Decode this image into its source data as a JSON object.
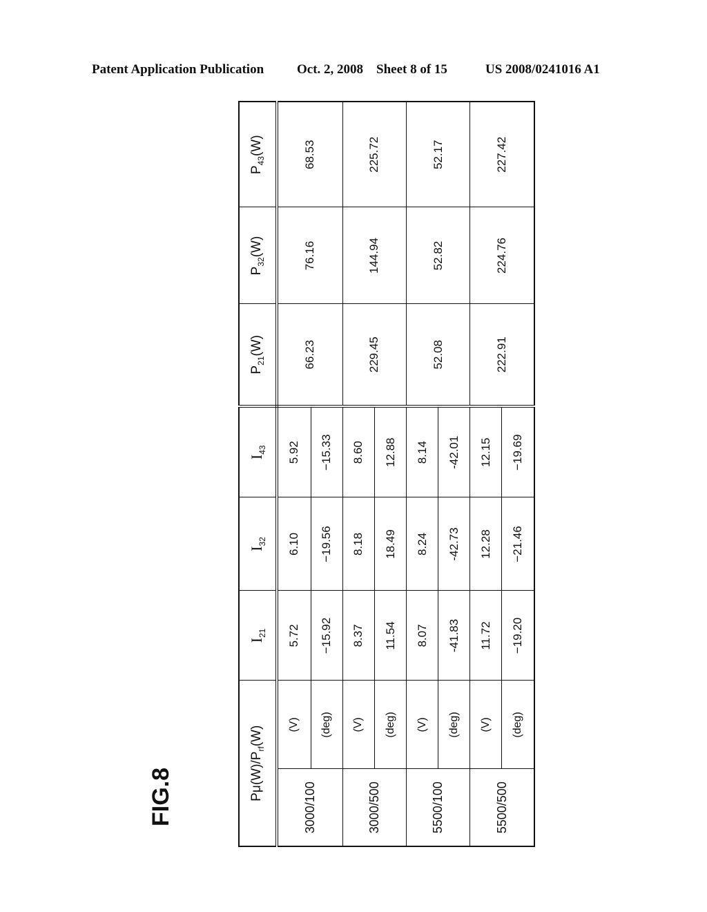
{
  "header": {
    "publication": "Patent Application Publication",
    "date": "Oct. 2, 2008",
    "sheet": "Sheet 8 of 15",
    "number": "US 2008/0241016 A1"
  },
  "figure_label": "FIG.8",
  "table": {
    "columns": {
      "condition": {
        "main": "P",
        "mu": "μ",
        "w1": "(W)/P",
        "sub": "rf",
        "w2": "(W)"
      },
      "I21": {
        "main": "I",
        "sub": "21"
      },
      "I32": {
        "main": "I",
        "sub": "32"
      },
      "I43": {
        "main": "I",
        "sub": "43"
      },
      "P21": {
        "main": "P",
        "sub": "21",
        "unit": "(W)"
      },
      "P32": {
        "main": "P",
        "sub": "32",
        "unit": "(W)"
      },
      "P43": {
        "main": "P",
        "sub": "43",
        "unit": "(W)"
      }
    },
    "groups": [
      {
        "condition": "3000/100",
        "v": {
          "unit": "(V)",
          "I21": "5.72",
          "I32": "6.10",
          "I43": "5.92"
        },
        "deg": {
          "unit": "(deg)",
          "I21": "−15.92",
          "I32": "−19.56",
          "I43": "−15.33"
        },
        "P21": "66.23",
        "P32": "76.16",
        "P43": "68.53"
      },
      {
        "condition": "3000/500",
        "v": {
          "unit": "(V)",
          "I21": "8.37",
          "I32": "8.18",
          "I43": "8.60"
        },
        "deg": {
          "unit": "(deg)",
          "I21": "11.54",
          "I32": "18.49",
          "I43": "12.88"
        },
        "P21": "229.45",
        "P32": "144.94",
        "P43": "225.72"
      },
      {
        "condition": "5500/100",
        "v": {
          "unit": "(V)",
          "I21": "8.07",
          "I32": "8.24",
          "I43": "8.14"
        },
        "deg": {
          "unit": "(deg)",
          "I21": "-41.83",
          "I32": "-42.73",
          "I43": "-42.01"
        },
        "P21": "52.08",
        "P32": "52.82",
        "P43": "52.17"
      },
      {
        "condition": "5500/500",
        "v": {
          "unit": "(V)",
          "I21": "11.72",
          "I32": "12.28",
          "I43": "12.15"
        },
        "deg": {
          "unit": "(deg)",
          "I21": "−19.20",
          "I32": "−21.46",
          "I43": "−19.69"
        },
        "P21": "222.91",
        "P32": "224.76",
        "P43": "227.42"
      }
    ]
  }
}
